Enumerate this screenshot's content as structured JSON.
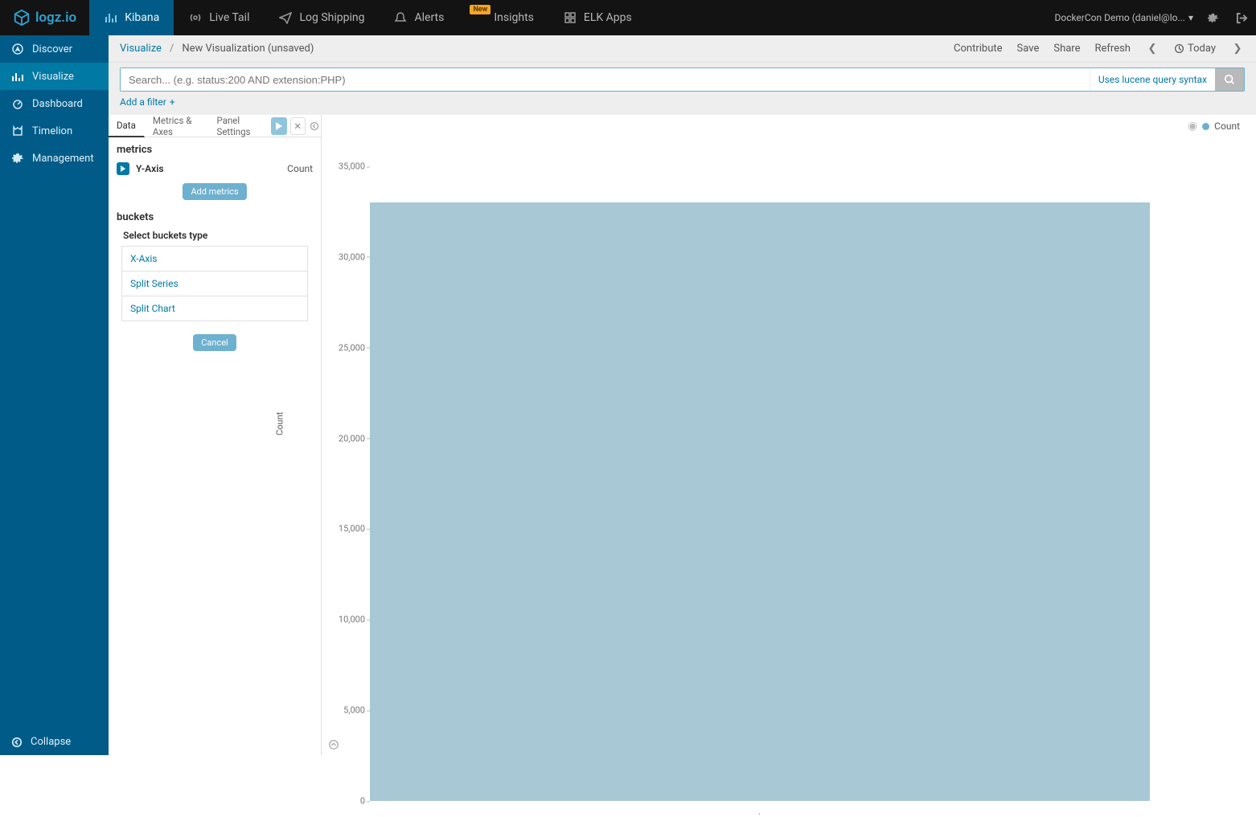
{
  "brand": "logz.io",
  "topnav": {
    "tabs": [
      {
        "label": "Kibana",
        "icon": "bar-chart",
        "active": true
      },
      {
        "label": "Live Tail",
        "icon": "broadcast"
      },
      {
        "label": "Log Shipping",
        "icon": "paper-plane"
      },
      {
        "label": "Alerts",
        "icon": "bell"
      },
      {
        "label": "Insights",
        "icon": "insights",
        "badge": "New"
      },
      {
        "label": "ELK Apps",
        "icon": "apps"
      }
    ],
    "user": "DockerCon Demo (daniel@lo...",
    "user_caret": "▾"
  },
  "sidebar": {
    "items": [
      {
        "label": "Discover",
        "icon": "compass"
      },
      {
        "label": "Visualize",
        "icon": "visualize",
        "active": true
      },
      {
        "label": "Dashboard",
        "icon": "dashboard"
      },
      {
        "label": "Timelion",
        "icon": "timelion"
      },
      {
        "label": "Management",
        "icon": "gear"
      }
    ],
    "collapse": "Collapse"
  },
  "breadcrumb": {
    "root": "Visualize",
    "sep": "/",
    "current": "New Visualization (unsaved)"
  },
  "actions": {
    "contribute": "Contribute",
    "save": "Save",
    "share": "Share",
    "refresh": "Refresh",
    "time": "Today"
  },
  "search": {
    "placeholder": "Search... (e.g. status:200 AND extension:PHP)",
    "lucene_hint": "Uses lucene query syntax"
  },
  "filter": {
    "add": "Add a filter"
  },
  "editor": {
    "tabs": [
      "Data",
      "Metrics & Axes",
      "Panel Settings"
    ],
    "metrics_title": "metrics",
    "metric_axis": "Y-Axis",
    "metric_value": "Count",
    "add_metrics": "Add metrics",
    "buckets_title": "buckets",
    "buckets_instr": "Select buckets type",
    "bucket_options": [
      "X-Axis",
      "Split Series",
      "Split Chart"
    ],
    "cancel": "Cancel"
  },
  "chart_data": {
    "type": "bar",
    "categories": [
      "-"
    ],
    "values": [
      33000
    ],
    "series": [
      {
        "name": "Count",
        "color": "#a7c8d4",
        "values": [
          33000
        ]
      }
    ],
    "ylabel": "Count",
    "ylim": [
      0,
      35000
    ],
    "yticks": [
      0,
      5000,
      10000,
      15000,
      20000,
      25000,
      30000,
      35000
    ],
    "ytick_labels": [
      "0",
      "5,000",
      "10,000",
      "15,000",
      "20,000",
      "25,000",
      "30,000",
      "35,000"
    ],
    "legend": "Count"
  }
}
